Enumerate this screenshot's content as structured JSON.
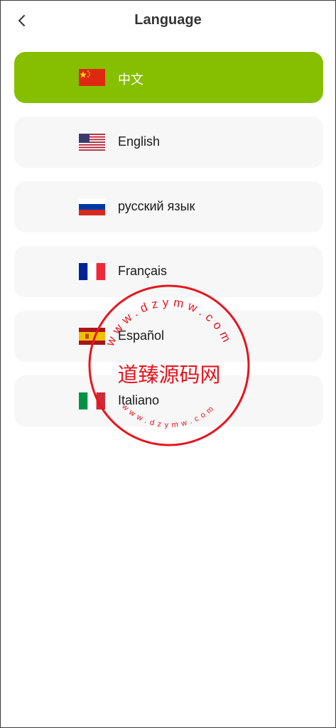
{
  "header": {
    "title": "Language"
  },
  "languages": [
    {
      "label": "中文",
      "selected": true
    },
    {
      "label": "English",
      "selected": false
    },
    {
      "label": "русский язык",
      "selected": false
    },
    {
      "label": "Français",
      "selected": false
    },
    {
      "label": "Español",
      "selected": false
    },
    {
      "label": "Italiano",
      "selected": false
    }
  ],
  "watermark": {
    "name": "道臻源码网",
    "url_top": "www.dzymw.com",
    "url_bottom": "www.dzymw.com",
    "color": "#e8141e"
  },
  "colors": {
    "accent": "#86bf00",
    "item_bg": "#f7f7f7"
  }
}
